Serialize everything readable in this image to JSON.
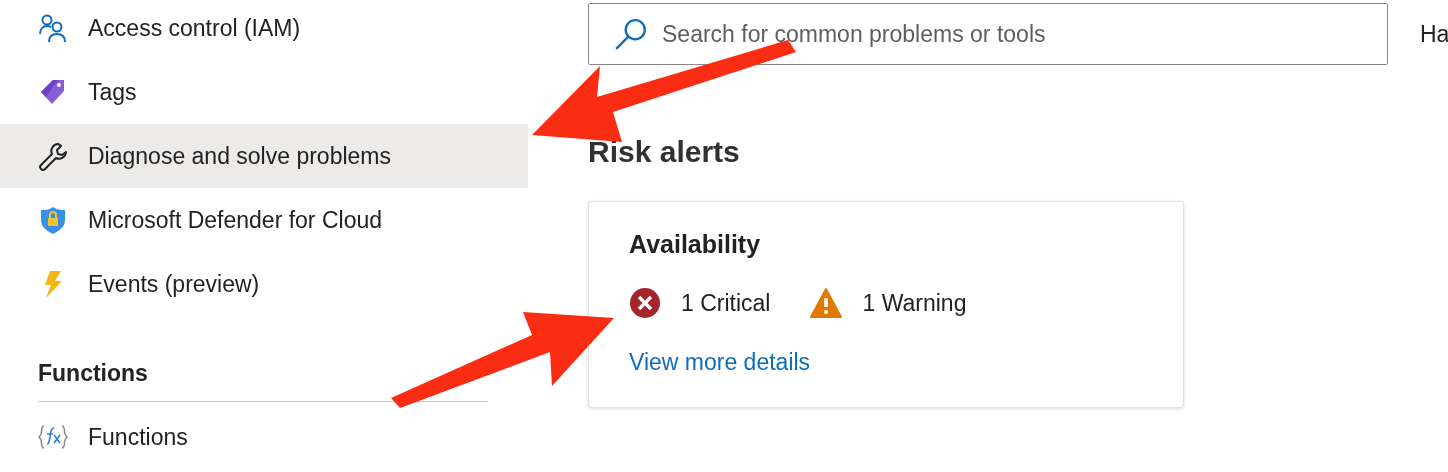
{
  "sidebar": {
    "items": [
      {
        "label": "Access control (IAM)",
        "kind": "people",
        "selected": false
      },
      {
        "label": "Tags",
        "kind": "tag",
        "selected": false
      },
      {
        "label": "Diagnose and solve problems",
        "kind": "wrench",
        "selected": true
      },
      {
        "label": "Microsoft Defender for Cloud",
        "kind": "shield",
        "selected": false
      },
      {
        "label": "Events (preview)",
        "kind": "bolt",
        "selected": false
      }
    ],
    "sections": [
      {
        "heading": "Functions",
        "items": [
          {
            "label": "Functions",
            "kind": "function",
            "selected": false
          }
        ]
      }
    ]
  },
  "search": {
    "placeholder": "Search for common problems or tools"
  },
  "header_cut_text": "Ha",
  "risk_alerts": {
    "title": "Risk alerts",
    "card": {
      "title": "Availability",
      "alerts": [
        {
          "kind": "critical",
          "text": "1 Critical"
        },
        {
          "kind": "warning",
          "text": "1 Warning"
        }
      ],
      "link": "View more details"
    }
  }
}
